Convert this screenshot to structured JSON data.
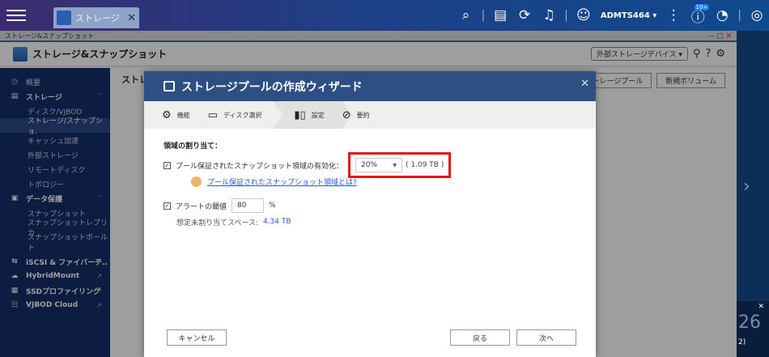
{
  "topbar": {
    "tab_title": "ストレージ",
    "tab_close": "✕",
    "user_name": "ADMTS464 ▾",
    "badge": "10+"
  },
  "window": {
    "title": "ストレージ&スナップショット",
    "controls": "— □",
    "close": "✕"
  },
  "app_header": {
    "title": "ストレージ&スナップショット",
    "external_device_btn": "外部ストレージデバイス ▾"
  },
  "sidebar": {
    "overview": "概要",
    "storage": "ストレージ",
    "storage_items": [
      "ディスク/VJBOD",
      "ストレージ/スナップショ.",
      "キャッシュ加速",
      "外部ストレージ",
      "リモートディスク",
      "トポロジー"
    ],
    "data_protection": "データ保護",
    "protection_items": [
      "スナップショット",
      "スナップショットレプリカ",
      "スナップショットボールト"
    ],
    "iscsi": "iSCSI & ファイバーチ..",
    "hybridmount": "HybridMount",
    "ssd": "SSDプロファイリング",
    "vjbod": "VJBOD Cloud"
  },
  "background": {
    "title": "ストレ",
    "btn_pool": "ストレージプール",
    "btn_volume": "新規ボリューム"
  },
  "wizard": {
    "title": "ストレージプールの作成ウィザード",
    "close": "✕",
    "steps": [
      "機能",
      "ディスク選択",
      "設定",
      "要約"
    ],
    "section_title": "領域の割り当て：",
    "snapshot_label": "プール保証されたスナップショット領域の有効化：",
    "snapshot_value": "20%",
    "snapshot_size": "( 1.09 TB )",
    "help_link": "プール保証されたスナップショット領域とは?",
    "alert_label": "アラートの閾値",
    "alert_value": "80",
    "alert_unit": "%",
    "free_label": "想定未割り当てスペース:",
    "free_value": "4.34 TB",
    "cancel": "キャンセル",
    "back": "戻る",
    "next": "次へ"
  },
  "right_panel": {
    "close": "✕",
    "number": "26",
    "small": "2)"
  }
}
